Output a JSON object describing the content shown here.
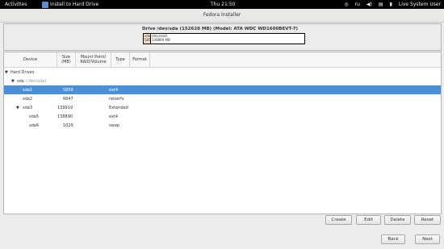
{
  "topbar": {
    "activities": "Activities",
    "app_title": "Install to Hard Drive",
    "clock": "Thu 21:50",
    "keyboard_layout": "ru",
    "user": "Live System User"
  },
  "window": {
    "title": "Fedora Installer"
  },
  "drive": {
    "label": "Drive /dev/sda (152628 MB) (Model: ATA WDC WD1600BEVT-7)",
    "segments": [
      {
        "name": "sda1",
        "line1": "sda",
        "line2": "5859"
      },
      {
        "name": "sda5",
        "line1": "/dev/sda5",
        "line2": "138890 MB"
      }
    ]
  },
  "table": {
    "columns": [
      "Device",
      "Size (MB)",
      "Mount Point/ RAID/Volume",
      "Type",
      "Format"
    ],
    "group_label": "Hard Drives",
    "rows": [
      {
        "device": "sda",
        "extra": "(/dev/sda)",
        "size": "",
        "mount": "",
        "type": "",
        "level": 1
      },
      {
        "device": "sda1",
        "size": "5859",
        "mount": "",
        "type": "ext4",
        "level": 2,
        "selected": true
      },
      {
        "device": "sda2",
        "size": "6847",
        "mount": "",
        "type": "reiserfs",
        "level": 2
      },
      {
        "device": "sda3",
        "size": "139919",
        "mount": "",
        "type": "Extended",
        "level": 2
      },
      {
        "device": "sda5",
        "size": "138890",
        "mount": "",
        "type": "ext4",
        "level": 3
      },
      {
        "device": "sda6",
        "size": "1029",
        "mount": "",
        "type": "swap",
        "level": 3
      }
    ]
  },
  "actions": {
    "create": "Create",
    "edit": "Edit",
    "delete": "Delete",
    "reset": "Reset"
  },
  "nav": {
    "back": "Back",
    "next": "Next"
  }
}
